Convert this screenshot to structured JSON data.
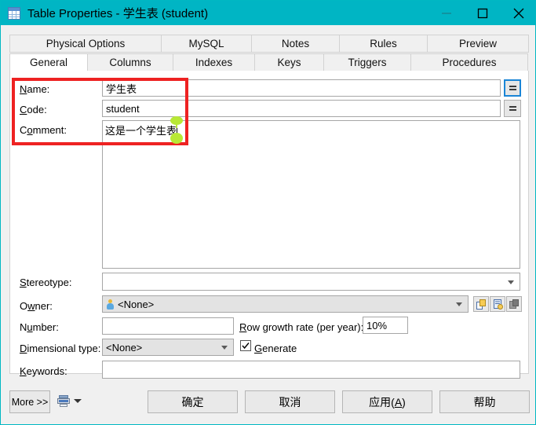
{
  "window": {
    "title": "Table Properties - 学生表 (student)",
    "icon": "table-icon",
    "accent_color": "#00b5c4",
    "controls": {
      "minimize": "minimize-icon",
      "maximize": "maximize-icon",
      "close": "close-icon"
    }
  },
  "tabs": {
    "top_row": [
      {
        "label": "Physical Options",
        "selected": false
      },
      {
        "label": "MySQL",
        "selected": false
      },
      {
        "label": "Notes",
        "selected": false
      },
      {
        "label": "Rules",
        "selected": false
      },
      {
        "label": "Preview",
        "selected": false
      }
    ],
    "bottom_row": [
      {
        "label": "General",
        "selected": true
      },
      {
        "label": "Columns",
        "selected": false
      },
      {
        "label": "Indexes",
        "selected": false
      },
      {
        "label": "Keys",
        "selected": false
      },
      {
        "label": "Triggers",
        "selected": false
      },
      {
        "label": "Procedures",
        "selected": false
      }
    ]
  },
  "general": {
    "name_label": "Name:",
    "name_value": "学生表",
    "code_label": "Code:",
    "code_value": "student",
    "comment_label": "Comment:",
    "comment_value": "这是一个学生表",
    "stereotype_label": "Stereotype:",
    "stereotype_value": "",
    "owner_label": "Owner:",
    "owner_value": "<None>",
    "number_label": "Number:",
    "number_value": "",
    "row_growth_label": "Row growth rate (per year):",
    "row_growth_value": "10%",
    "dimensional_label": "Dimensional type:",
    "dimensional_value": "<None>",
    "generate_label": "Generate",
    "generate_checked": true,
    "keywords_label": "Keywords:",
    "keywords_value": "",
    "equals_button_label": "=",
    "owner_new_icon": "new-object-icon",
    "owner_props_icon": "object-properties-icon",
    "owner_delete_icon": "delete-object-icon"
  },
  "annotation": {
    "highlight_color": "#ee2222",
    "handle_color": "#b8e835"
  },
  "footer": {
    "more_label": "More >>",
    "print_icon": "print-report-icon",
    "ok_label": "确定",
    "cancel_label": "取消",
    "apply_label_pre": "应用(",
    "apply_label_key": "A",
    "apply_label_post": ")",
    "help_label": "帮助"
  }
}
